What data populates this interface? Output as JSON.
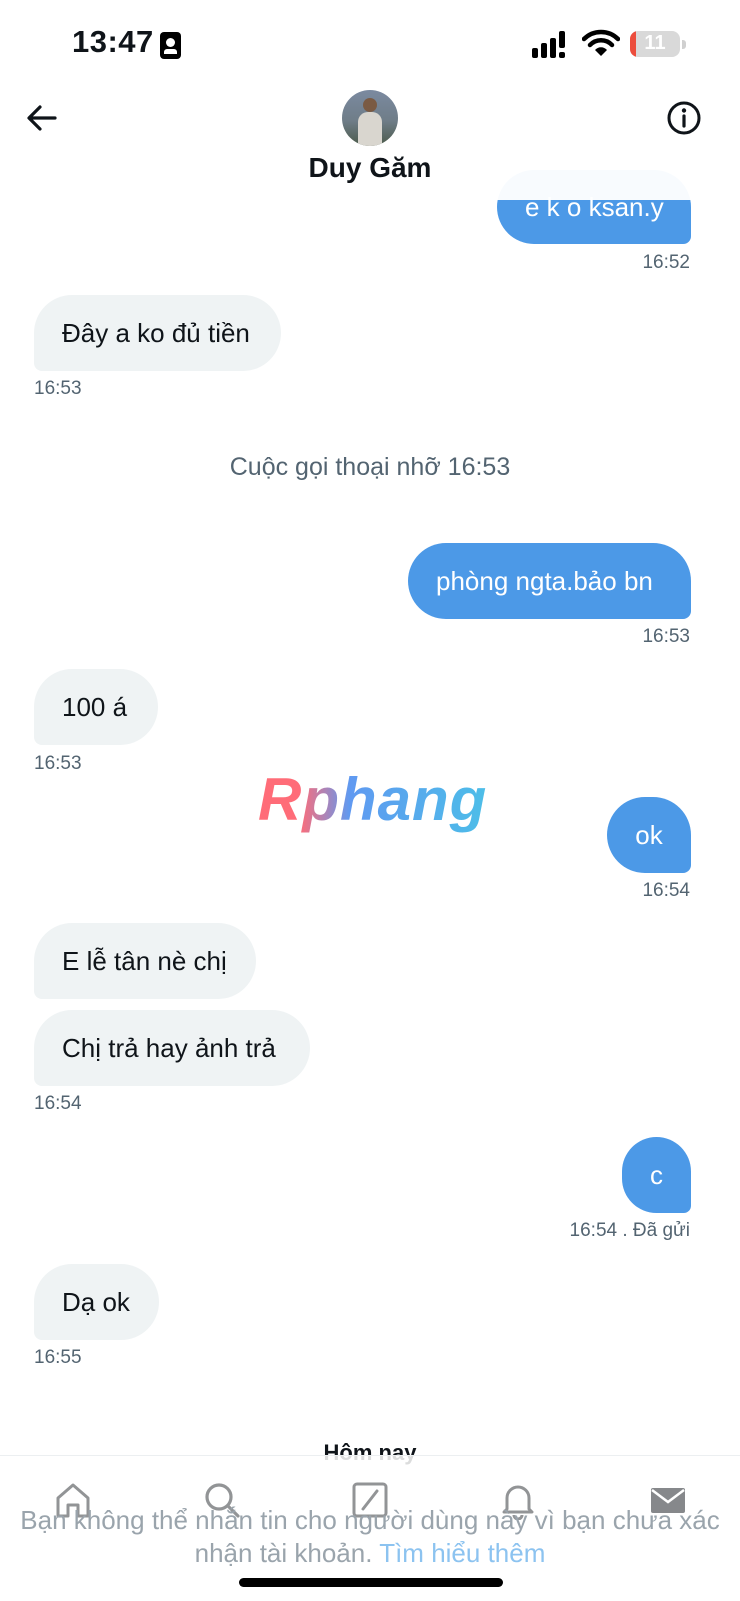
{
  "status_bar": {
    "time": "13:47",
    "battery": "11",
    "battery_level": 0.11
  },
  "header": {
    "contact_name": "Duy Găm"
  },
  "messages": [
    {
      "dir": "out",
      "text": "e k o ksan.y",
      "time": "16:52"
    },
    {
      "dir": "in",
      "text": "Đây a ko đủ tiền",
      "time": "16:53"
    },
    {
      "dir": "system",
      "text": "Cuộc gọi thoại nhỡ 16:53"
    },
    {
      "dir": "out",
      "text": "phòng ngta.bảo bn",
      "time": "16:53"
    },
    {
      "dir": "in",
      "text": "100 á",
      "time": "16:53"
    },
    {
      "dir": "out",
      "text": "ok",
      "time": "16:54"
    },
    {
      "dir": "in",
      "text": "E lễ tân nè chị"
    },
    {
      "dir": "in",
      "text": "Chị trả hay ảnh trả",
      "time": "16:54"
    },
    {
      "dir": "out",
      "text": "c",
      "time": "16:54",
      "status": ". Đã gửi"
    },
    {
      "dir": "in",
      "text": "Dạ ok",
      "time": "16:55"
    }
  ],
  "divider": {
    "today": "Hôm nay"
  },
  "watermark": "Rphang",
  "footer": {
    "notice": "Bạn không thể nhắn tin cho người dùng này vì bạn chưa xác nhận tài khoản.",
    "learn_more": "Tìm hiểu thêm"
  },
  "tab_bar": [
    "home-icon",
    "search-icon",
    "compose-icon",
    "bell-icon",
    "mail-icon"
  ],
  "colors": {
    "outgoing_bubble": "#4c99e7",
    "incoming_bubble": "#eff3f4",
    "link": "#8cc3f0"
  }
}
